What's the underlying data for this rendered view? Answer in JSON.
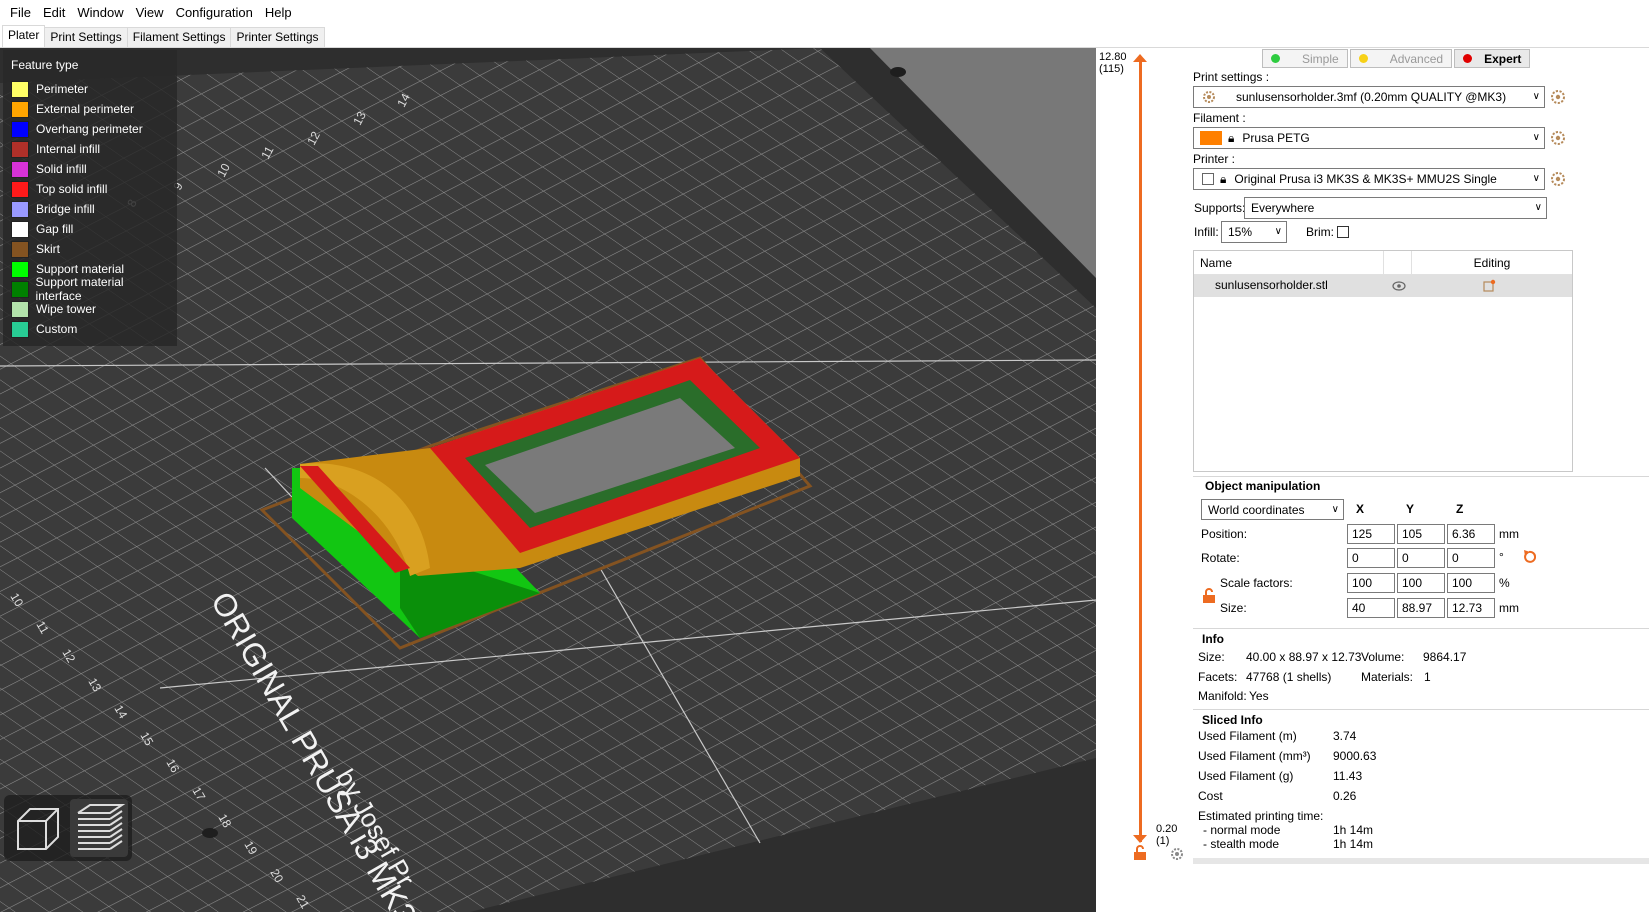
{
  "menu": [
    "File",
    "Edit",
    "Window",
    "View",
    "Configuration",
    "Help"
  ],
  "tabs": [
    "Plater",
    "Print Settings",
    "Filament Settings",
    "Printer Settings"
  ],
  "legend": {
    "title": "Feature type",
    "items": [
      {
        "label": "Perimeter",
        "color": "#ffff66"
      },
      {
        "label": "External perimeter",
        "color": "#ffa500"
      },
      {
        "label": "Overhang perimeter",
        "color": "#0000ff"
      },
      {
        "label": "Internal infill",
        "color": "#b03029"
      },
      {
        "label": "Solid infill",
        "color": "#d732d7"
      },
      {
        "label": "Top solid infill",
        "color": "#ff1a1a"
      },
      {
        "label": "Bridge infill",
        "color": "#9999ff"
      },
      {
        "label": "Gap fill",
        "color": "#ffffff"
      },
      {
        "label": "Skirt",
        "color": "#845321"
      },
      {
        "label": "Support material",
        "color": "#00ff00"
      },
      {
        "label": "Support material interface",
        "color": "#008000"
      },
      {
        "label": "Wipe tower",
        "color": "#b3e3ab"
      },
      {
        "label": "Custom",
        "color": "#28cc94"
      }
    ]
  },
  "bed": {
    "brand_line1": "ORIGINAL PRUSA i3 MK3",
    "brand_line2": "by Josef Pr",
    "top_numbers": [
      "14",
      "13",
      "12",
      "11",
      "10",
      "9",
      "8"
    ],
    "side_numbers": [
      "10",
      "11",
      "12",
      "13",
      "14",
      "15",
      "16",
      "17",
      "18",
      "19",
      "20",
      "21"
    ]
  },
  "slider": {
    "top_value": "12.80",
    "top_layer": "(115)",
    "bottom_value": "0.20",
    "bottom_layer": "(1)"
  },
  "modes": [
    {
      "label": "Simple",
      "color": "#2ecc40"
    },
    {
      "label": "Advanced",
      "color": "#f7d117"
    },
    {
      "label": "Expert",
      "color": "#e00000"
    }
  ],
  "print_settings": {
    "label": "Print settings :",
    "value": "sunlusensorholder.3mf (0.20mm QUALITY @MK3)"
  },
  "filament": {
    "label": "Filament :",
    "value": "Prusa PETG",
    "color": "#ff8000"
  },
  "printer": {
    "label": "Printer :",
    "value": "Original Prusa i3 MK3S & MK3S+ MMU2S Single"
  },
  "supports": {
    "label": "Supports:",
    "value": "Everywhere"
  },
  "infill": {
    "label": "Infill:",
    "value": "15%"
  },
  "brim": {
    "label": "Brim:"
  },
  "object_list": {
    "col_name": "Name",
    "col_editing": "Editing",
    "rows": [
      "sunlusensorholder.stl"
    ]
  },
  "manipulation": {
    "title": "Object manipulation",
    "coord_system": "World coordinates",
    "axes": [
      "X",
      "Y",
      "Z"
    ],
    "position": {
      "label": "Position:",
      "values": [
        "125",
        "105",
        "6.36"
      ],
      "unit": "mm"
    },
    "rotate": {
      "label": "Rotate:",
      "values": [
        "0",
        "0",
        "0"
      ],
      "unit": "°"
    },
    "scale": {
      "label": "Scale factors:",
      "values": [
        "100",
        "100",
        "100"
      ],
      "unit": "%"
    },
    "size": {
      "label": "Size:",
      "values": [
        "40",
        "88.97",
        "12.73"
      ],
      "unit": "mm"
    }
  },
  "info": {
    "title": "Info",
    "size_label": "Size:",
    "size_value": "40.00 x 88.97 x 12.73",
    "volume_label": "Volume:",
    "volume_value": "9864.17",
    "facets_label": "Facets:",
    "facets_value": "47768 (1 shells)",
    "materials_label": "Materials:",
    "materials_value": "1",
    "manifold_label": "Manifold:",
    "manifold_value": "Yes"
  },
  "sliced": {
    "title": "Sliced Info",
    "rows": [
      {
        "label": "Used Filament (m)",
        "value": "3.74"
      },
      {
        "label": "Used Filament (mm³)",
        "value": "9000.63"
      },
      {
        "label": "Used Filament (g)",
        "value": "11.43"
      },
      {
        "label": "Cost",
        "value": "0.26"
      }
    ],
    "time_title": "Estimated printing time:",
    "normal_label": "- normal mode",
    "normal_value": "1h 14m",
    "stealth_label": "- stealth mode",
    "stealth_value": "1h 14m"
  }
}
